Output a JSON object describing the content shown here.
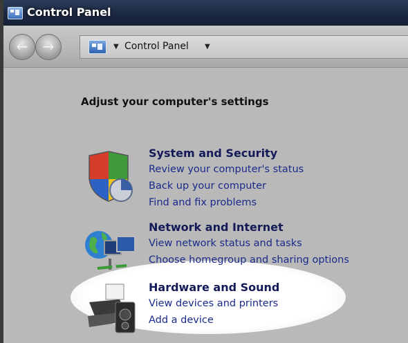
{
  "window": {
    "title": "Control Panel"
  },
  "address_bar": {
    "path": "Control Panel"
  },
  "main": {
    "heading": "Adjust your computer's settings",
    "categories": [
      {
        "title": "System and Security",
        "links": [
          "Review your computer's status",
          "Back up your computer",
          "Find and fix problems"
        ],
        "icon": "shield-icon"
      },
      {
        "title": "Network and Internet",
        "links": [
          "View network status and tasks",
          "Choose homegroup and sharing options"
        ],
        "icon": "network-globe-icon"
      },
      {
        "title": "Hardware and Sound",
        "links": [
          "View devices and printers",
          "Add a device"
        ],
        "icon": "printer-icon"
      }
    ]
  },
  "colors": {
    "title_bar": "#1a2740",
    "category_title": "#141a57",
    "link": "#1a2a8a",
    "highlight": "#ffffff"
  }
}
